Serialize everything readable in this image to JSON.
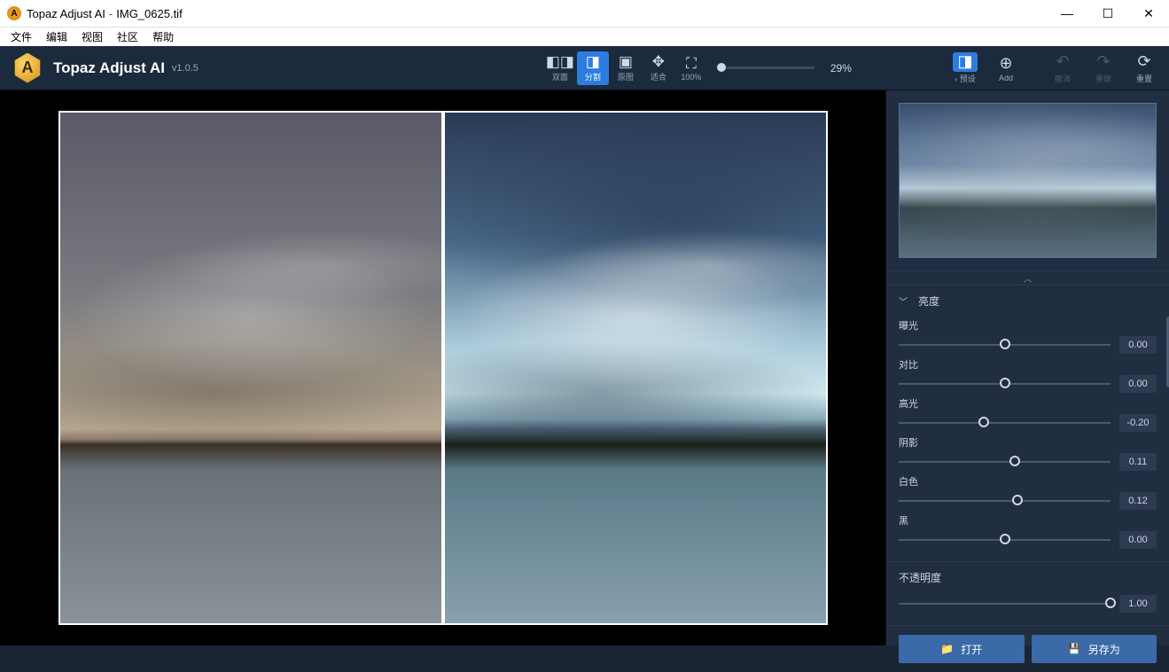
{
  "titlebar": {
    "app": "Topaz Adjust AI",
    "file": "IMG_0625.tif"
  },
  "menubar": [
    "文件",
    "编辑",
    "视图",
    "社区",
    "帮助"
  ],
  "header": {
    "title": "Topaz Adjust AI",
    "version": "v1.0.5"
  },
  "view_modes": [
    {
      "label": "双面",
      "icon": "◧|◨"
    },
    {
      "label": "分割",
      "icon": "◨",
      "active": true
    },
    {
      "label": "原图",
      "icon": "▣"
    },
    {
      "label": "适合",
      "icon": "✥"
    },
    {
      "label": "100%",
      "icon": "⛶"
    }
  ],
  "zoom": "29%",
  "header_right": {
    "preset_back": "‹",
    "preset": "预设",
    "add": "Add",
    "undo": "撤消",
    "redo": "重做",
    "reset": "重置"
  },
  "sections": {
    "brightness": {
      "title": "亮度",
      "sliders": [
        {
          "label": "曝光",
          "value": "0.00",
          "pos": 50
        },
        {
          "label": "对比",
          "value": "0.00",
          "pos": 50
        },
        {
          "label": "高光",
          "value": "-0.20",
          "pos": 40
        },
        {
          "label": "阴影",
          "value": "0.11",
          "pos": 55
        },
        {
          "label": "白色",
          "value": "0.12",
          "pos": 56
        },
        {
          "label": "黑",
          "value": "0.00",
          "pos": 50
        }
      ]
    },
    "opacity": {
      "title": "不透明度",
      "value": "1.00",
      "pos": 100
    }
  },
  "footer": {
    "open": "打开",
    "saveas": "另存为"
  }
}
